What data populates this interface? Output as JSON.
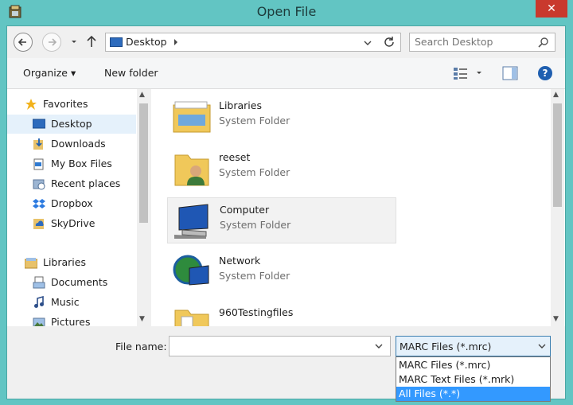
{
  "window": {
    "title": "Open File",
    "close_label": "✕"
  },
  "address": {
    "location": "Desktop",
    "search_placeholder": "Search Desktop"
  },
  "toolbar": {
    "organize_label": "Organize ▾",
    "new_folder_label": "New folder",
    "help_label": "?"
  },
  "nav": {
    "items": [
      {
        "label": "Favorites",
        "icon": "star-icon"
      },
      {
        "label": "Desktop",
        "icon": "desktop-icon",
        "selected": true
      },
      {
        "label": "Downloads",
        "icon": "downloads-icon"
      },
      {
        "label": "My Box Files",
        "icon": "box-icon"
      },
      {
        "label": "Recent places",
        "icon": "recent-places-icon"
      },
      {
        "label": "Dropbox",
        "icon": "dropbox-icon"
      },
      {
        "label": "SkyDrive",
        "icon": "skydrive-icon"
      },
      {
        "label": "Libraries",
        "icon": "libraries-icon"
      },
      {
        "label": "Documents",
        "icon": "documents-icon"
      },
      {
        "label": "Music",
        "icon": "music-icon"
      },
      {
        "label": "Pictures",
        "icon": "pictures-icon"
      }
    ]
  },
  "files": [
    {
      "name": "Libraries",
      "type": "System Folder",
      "icon": "libraries-folder-icon"
    },
    {
      "name": "reeset",
      "type": "System Folder",
      "icon": "user-folder-icon"
    },
    {
      "name": "Computer",
      "type": "System Folder",
      "icon": "computer-icon"
    },
    {
      "name": "Network",
      "type": "System Folder",
      "icon": "network-icon"
    },
    {
      "name": "960Testingfiles",
      "type": "",
      "icon": "folder-icon"
    }
  ],
  "bottom": {
    "file_name_label": "File name:",
    "file_name_value": "",
    "file_type_selected": "MARC Files (*.mrc)",
    "file_type_options": [
      "MARC Files (*.mrc)",
      "MARC Text Files (*.mrk)",
      "All Files (*.*)"
    ],
    "highlighted_option": "All Files (*.*)"
  },
  "colors": {
    "chrome": "#62c5c3",
    "close": "#c9392d",
    "selection": "#3399ff"
  }
}
